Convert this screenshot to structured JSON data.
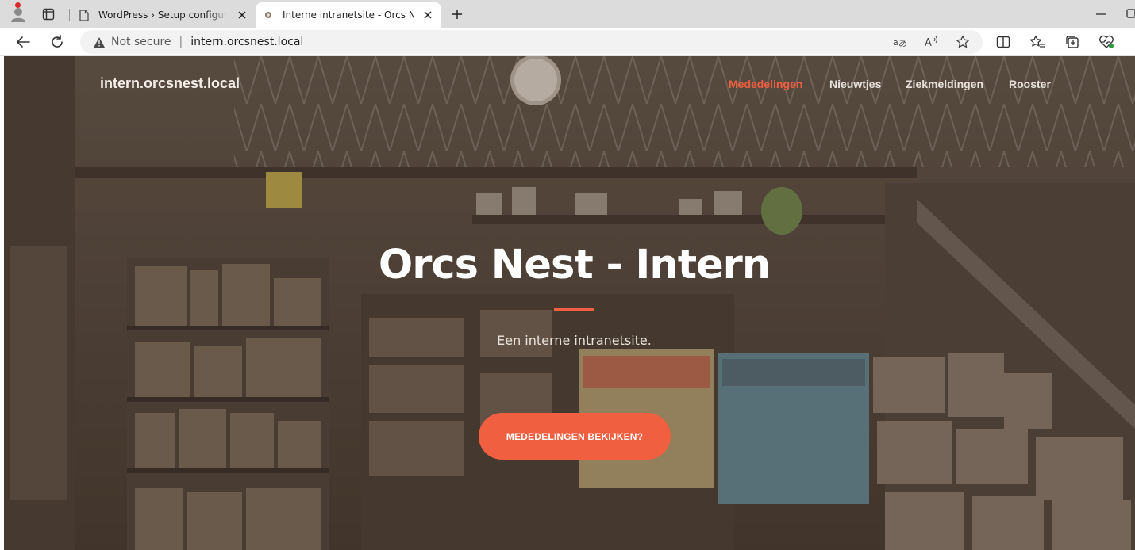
{
  "browser": {
    "tabs": [
      {
        "title": "WordPress › Setup configuratiebestand",
        "active": false
      },
      {
        "title": "Interne intranetsite - Orcs Nest",
        "active": true
      }
    ],
    "address_bar": {
      "security_label": "Not secure",
      "url": "intern.orcsnest.local"
    },
    "icons": {
      "profile": "profile-icon",
      "tab_actions": "tab-actions-icon",
      "favicon_1": "document-icon",
      "favicon_2": "site-icon",
      "close": "close-icon",
      "new_tab": "plus-icon",
      "minimize": "minimize-icon",
      "maximize": "maximize-icon",
      "back": "back-arrow-icon",
      "reload": "reload-icon",
      "warning": "warning-icon",
      "translate": "translate-icon",
      "read_aloud": "read-aloud-icon",
      "favorite": "star-icon",
      "split_screen": "split-screen-icon",
      "favorites": "favorites-icon",
      "collections": "collections-icon",
      "browser_essentials": "heart-pulse-icon"
    }
  },
  "site": {
    "brand": "intern.orcsnest.local",
    "nav": [
      {
        "label": "Mededelingen",
        "active": true
      },
      {
        "label": "Nieuwtjes",
        "active": false
      },
      {
        "label": "Ziekmeldingen",
        "active": false
      },
      {
        "label": "Rooster",
        "active": false
      }
    ],
    "hero": {
      "title": "Orcs Nest - Intern",
      "subtitle": "Een interne intranetsite.",
      "cta_label": "MEDEDELINGEN BEKIJKEN?"
    },
    "background": "photo-of-board-game-shop-interior"
  },
  "colors": {
    "accent": "#f05f40",
    "tabstrip": "#dcdcdc",
    "omnibox": "#f2f2f2"
  }
}
